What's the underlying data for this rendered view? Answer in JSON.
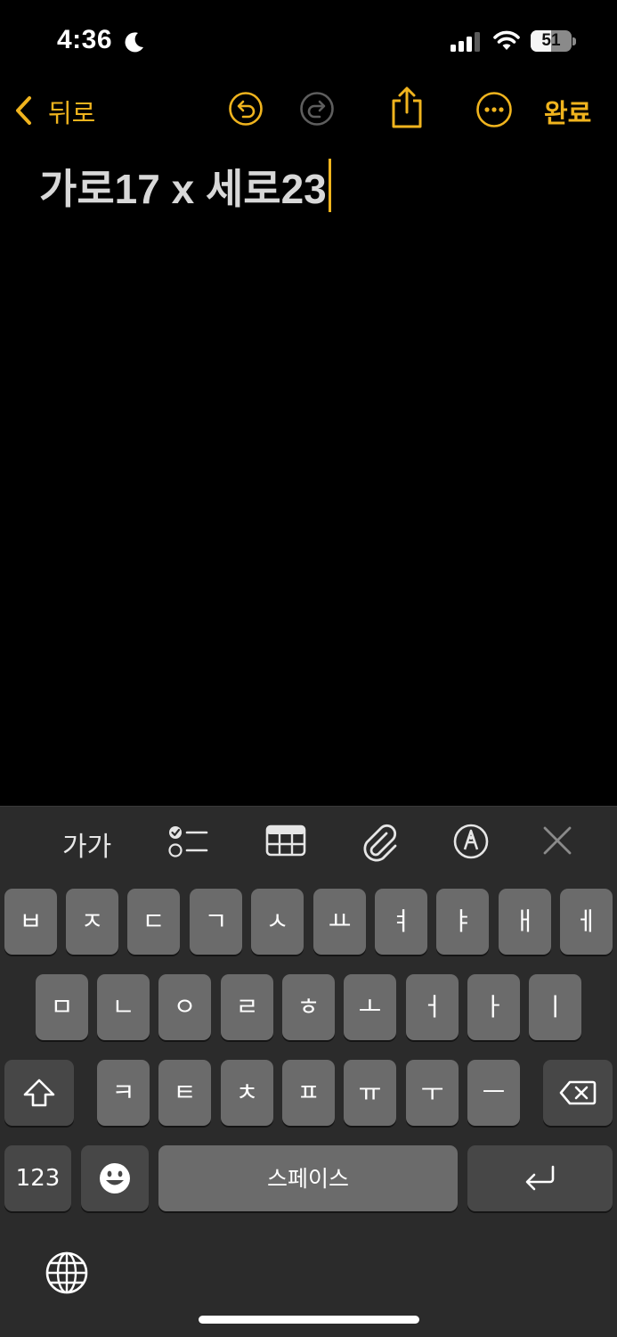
{
  "status_bar": {
    "time": "4:36",
    "battery_level": "51"
  },
  "toolbar": {
    "back_label": "뒤로",
    "done_label": "완료"
  },
  "note": {
    "text": "가로17 x 세로23"
  },
  "format_bar": {
    "text_style_label": "가가"
  },
  "keyboard": {
    "row1": [
      "ㅂ",
      "ㅈ",
      "ㄷ",
      "ㄱ",
      "ㅅ",
      "ㅛ",
      "ㅕ",
      "ㅑ",
      "ㅐ",
      "ㅔ"
    ],
    "row2": [
      "ㅁ",
      "ㄴ",
      "ㅇ",
      "ㄹ",
      "ㅎ",
      "ㅗ",
      "ㅓ",
      "ㅏ",
      "ㅣ"
    ],
    "row3": [
      "ㅋ",
      "ㅌ",
      "ㅊ",
      "ㅍ",
      "ㅠ",
      "ㅜ",
      "ㅡ"
    ],
    "numbers_label": "123",
    "space_label": "스페이스"
  },
  "colors": {
    "accent": "#f0b41e",
    "background": "#000000",
    "keyboard_bg": "#2b2b2b",
    "key_bg": "#6b6b6b",
    "key_dark_bg": "#474747"
  },
  "icons": {
    "status": [
      "moon-icon",
      "cellular-signal-icon",
      "wifi-icon",
      "battery-icon"
    ],
    "toolbar": [
      "back-chevron-icon",
      "undo-icon",
      "redo-icon",
      "share-icon",
      "more-icon"
    ],
    "format_bar": [
      "checklist-icon",
      "table-icon",
      "attachment-icon",
      "markup-icon",
      "close-icon"
    ],
    "keyboard": [
      "shift-icon",
      "delete-icon",
      "emoji-icon",
      "return-icon",
      "globe-icon"
    ]
  }
}
